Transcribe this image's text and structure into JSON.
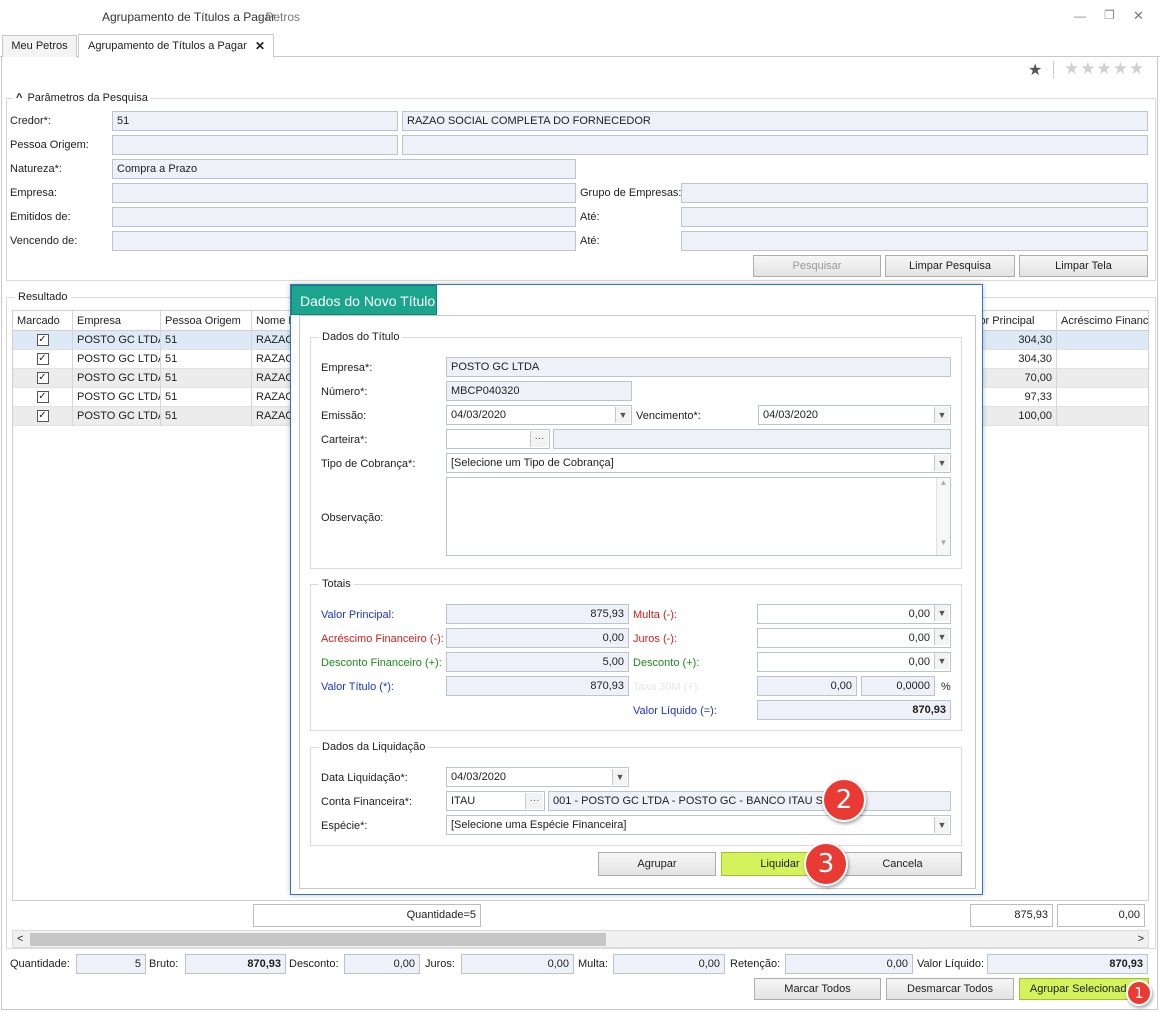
{
  "window": {
    "title": "Agrupamento de Títulos a Pagar",
    "app": " - Petros",
    "minimize_icon": "—",
    "restore_icon": "❐",
    "close_icon": "✕"
  },
  "tabs": [
    {
      "label": "Meu Petros"
    },
    {
      "label": "Agrupamento de Títulos a Pagar",
      "close": "✕"
    }
  ],
  "rating": {
    "favorite": "★",
    "stars": "★★★★★"
  },
  "search": {
    "title": "Parâmetros da Pesquisa",
    "collapse_icon": "^",
    "credor_label": "Credor*:",
    "credor_code": "51",
    "credor_name": "RAZAO SOCIAL COMPLETA DO FORNECEDOR",
    "pessoa_origem_label": "Pessoa Origem:",
    "natureza_label": "Natureza*:",
    "natureza_value": "Compra a Prazo",
    "empresa_label": "Empresa:",
    "grupo_label": "Grupo de Empresas:",
    "emitidos_label": "Emitidos de:",
    "ate_label": "Até:",
    "vencendo_label": "Vencendo de:",
    "btn_pesquisar": "Pesquisar",
    "btn_limpar_pesquisa": "Limpar Pesquisa",
    "btn_limpar_tela": "Limpar Tela"
  },
  "results": {
    "title": "Resultado",
    "columns": [
      "Marcado",
      "Empresa",
      "Pessoa Origem",
      "Nome F",
      "lor Principal",
      "Acréscimo Finance"
    ],
    "rows": [
      {
        "marcado": "✓",
        "empresa": "POSTO GC LTDA",
        "pessoa": "51",
        "nome": "RAZAO",
        "valor": "304,30"
      },
      {
        "marcado": "✓",
        "empresa": "POSTO GC LTDA",
        "pessoa": "51",
        "nome": "RAZAO",
        "valor": "304,30"
      },
      {
        "marcado": "✓",
        "empresa": "POSTO GC LTDA",
        "pessoa": "51",
        "nome": "RAZAO",
        "valor": "70,00"
      },
      {
        "marcado": "✓",
        "empresa": "POSTO GC LTDA",
        "pessoa": "51",
        "nome": "RAZAO",
        "valor": "97,33"
      },
      {
        "marcado": "✓",
        "empresa": "POSTO GC LTDA",
        "pessoa": "51",
        "nome": "RAZAO",
        "valor": "100,00"
      }
    ],
    "footer_quantidade": "Quantidade=5",
    "footer_valor": "875,93",
    "footer_acrescimo": "0,00",
    "scroll_left": "<",
    "scroll_right": ">"
  },
  "totals_bar": {
    "quantidade_label": "Quantidade:",
    "quantidade": "5",
    "bruto_label": "Bruto:",
    "bruto": "870,93",
    "desconto_label": "Desconto:",
    "desconto": "0,00",
    "juros_label": "Juros:",
    "juros": "0,00",
    "multa_label": "Multa:",
    "multa": "0,00",
    "retencao_label": "Retenção:",
    "retencao": "0,00",
    "liquido_label": "Valor Líquido:",
    "liquido": "870,93"
  },
  "actions": {
    "marcar": "Marcar Todos",
    "desmarcar": "Desmarcar Todos",
    "agrupar": "Agrupar Selecionados"
  },
  "dialog": {
    "title": "Dados do Novo Título",
    "dados": {
      "title": "Dados do Título",
      "empresa_label": "Empresa*:",
      "empresa": "POSTO GC LTDA",
      "numero_label": "Número*:",
      "numero": "MBCP040320",
      "emissao_label": "Emissão:",
      "emissao": "04/03/2020",
      "vencimento_label": "Vencimento*:",
      "vencimento": "04/03/2020",
      "carteira_label": "Carteira*:",
      "ellipsis": "···",
      "tipo_label": "Tipo de Cobrança*:",
      "tipo": "[Selecione um Tipo de Cobrança]",
      "obs_label": "Observação:"
    },
    "totais": {
      "title": "Totais",
      "vp_label": "Valor Principal:",
      "vp": "875,93",
      "multa_label": "Multa (-):",
      "multa": "0,00",
      "acr_label": "Acréscimo Financeiro (-):",
      "acr": "0,00",
      "juros_label": "Juros (-):",
      "juros": "0,00",
      "desc_fin_label": "Desconto Financeiro (+):",
      "desc_fin": "5,00",
      "desc_label": "Desconto (+):",
      "desc": "0,00",
      "vt_label": "Valor Título (*):",
      "vt": "870,93",
      "taxa_label": "Taxa 30M (+):",
      "taxa": "0,00",
      "taxa_pct": "0,0000",
      "pct": "%",
      "vl_label": "Valor Líquido (=):",
      "vl": "870,93"
    },
    "liquidacao": {
      "title": "Dados da Liquidação",
      "data_label": "Data Liquidação*:",
      "data": "04/03/2020",
      "conta_label": "Conta Financeira*:",
      "conta_code": "ITAU",
      "conta_desc": "001 - POSTO GC LTDA - POSTO GC - BANCO ITAU S/A",
      "especie_label": "Espécie*:",
      "especie": "[Selecione uma Espécie Financeira]"
    },
    "btn_agrupar": "Agrupar",
    "btn_liquidar": "Liquidar",
    "btn_cancela": "Cancela"
  },
  "badges": {
    "b1": "1",
    "b2": "2",
    "b3": "3"
  },
  "colors": {
    "accent_teal": "#1aa58c",
    "highlight_green": "#d3f25c",
    "badge_red": "#e93a33"
  }
}
